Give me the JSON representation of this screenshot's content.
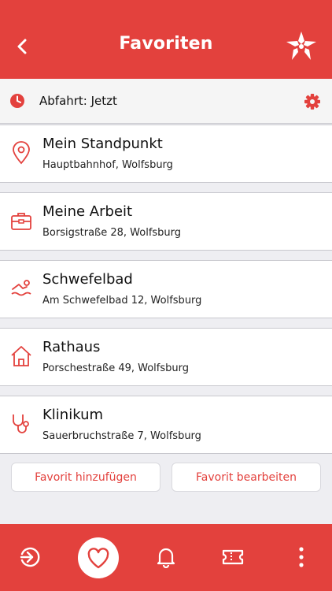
{
  "header": {
    "title": "Favoriten",
    "back_icon": "chevron-left-icon",
    "logo": "brand-star-logo"
  },
  "departure": {
    "label": "Abfahrt: Jetzt",
    "clock_icon": "clock-icon",
    "settings_icon": "gear-icon"
  },
  "favorites": [
    {
      "title": "Mein Standpunkt",
      "subtitle": "Hauptbahnhof, Wolfsburg",
      "icon": "location-pin-icon"
    },
    {
      "title": "Meine Arbeit",
      "subtitle": "Borsigstraße 28, Wolfsburg",
      "icon": "briefcase-icon"
    },
    {
      "title": "Schwefelbad",
      "subtitle": "Am Schwefelbad 12, Wolfsburg",
      "icon": "swimmer-icon"
    },
    {
      "title": "Rathaus",
      "subtitle": "Porschestraße 49, Wolfsburg",
      "icon": "house-icon"
    },
    {
      "title": "Klinikum",
      "subtitle": "Sauerbruchstraße 7, Wolfsburg",
      "icon": "stethoscope-icon"
    }
  ],
  "actions": {
    "add_label": "Favorit hinzufügen",
    "edit_label": "Favorit bearbeiten"
  },
  "tabbar": {
    "items": [
      "route-icon",
      "heart-icon",
      "bell-icon",
      "ticket-icon",
      "more-icon"
    ],
    "active": "heart-icon"
  },
  "colors": {
    "accent": "#e3413d",
    "background": "#eeeef2",
    "card": "#ffffff"
  }
}
